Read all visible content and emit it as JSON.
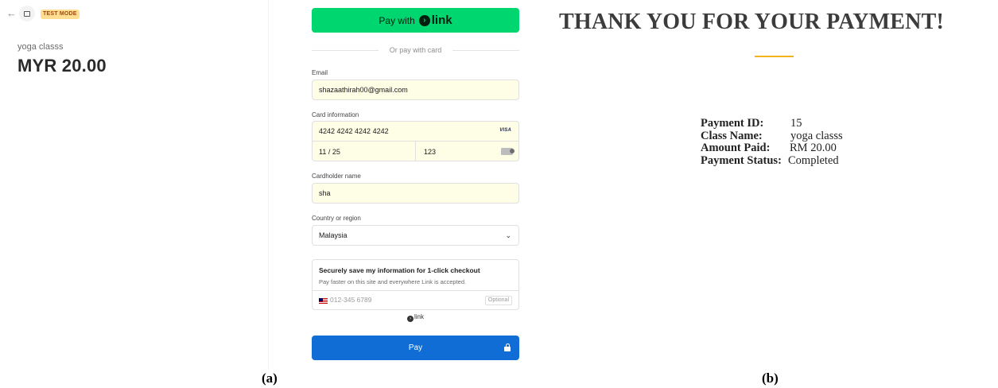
{
  "panel_a": {
    "back_glyph": "←",
    "test_badge": "TEST MODE",
    "product_name": "yoga classs",
    "price": "MYR 20.00",
    "link_button": {
      "prefix": "Pay with",
      "logo_glyph": "›",
      "logo_text": "link"
    },
    "divider_text": "Or pay with card",
    "email": {
      "label": "Email",
      "value": "shazaathirah00@gmail.com"
    },
    "card": {
      "label": "Card information",
      "number": "4242 4242 4242 4242",
      "brand": "VISA",
      "expiry": "11 / 25",
      "cvc": "123",
      "cvc_icon": "card-back-icon"
    },
    "cardholder": {
      "label": "Cardholder name",
      "value": "sha"
    },
    "country": {
      "label": "Country or region",
      "value": "Malaysia",
      "chevron": "⌄"
    },
    "save_info": {
      "title": "Securely save my information for 1-click checkout",
      "subtitle": "Pay faster on this site and everywhere Link is accepted.",
      "phone_placeholder": "012-345 6789",
      "optional": "Optional"
    },
    "link_footer": {
      "glyph": "›",
      "text": "link"
    },
    "pay_button": "Pay",
    "colors": {
      "link_green": "#00d66f",
      "pay_blue": "#0f6dd5",
      "autofill_yellow": "#fefde6",
      "test_badge": "#ffde92"
    }
  },
  "panel_b": {
    "title": "THANK YOU FOR YOUR PAYMENT!",
    "accent_color": "#f2b21a",
    "details": [
      {
        "key": "Payment ID:",
        "value": "15"
      },
      {
        "key": "Class Name:",
        "value": "yoga classs"
      },
      {
        "key": "Amount Paid:",
        "value": "RM 20.00"
      },
      {
        "key": "Payment Status:",
        "value": "Completed"
      }
    ]
  },
  "captions": {
    "a": "(a)",
    "b": "(b)"
  }
}
